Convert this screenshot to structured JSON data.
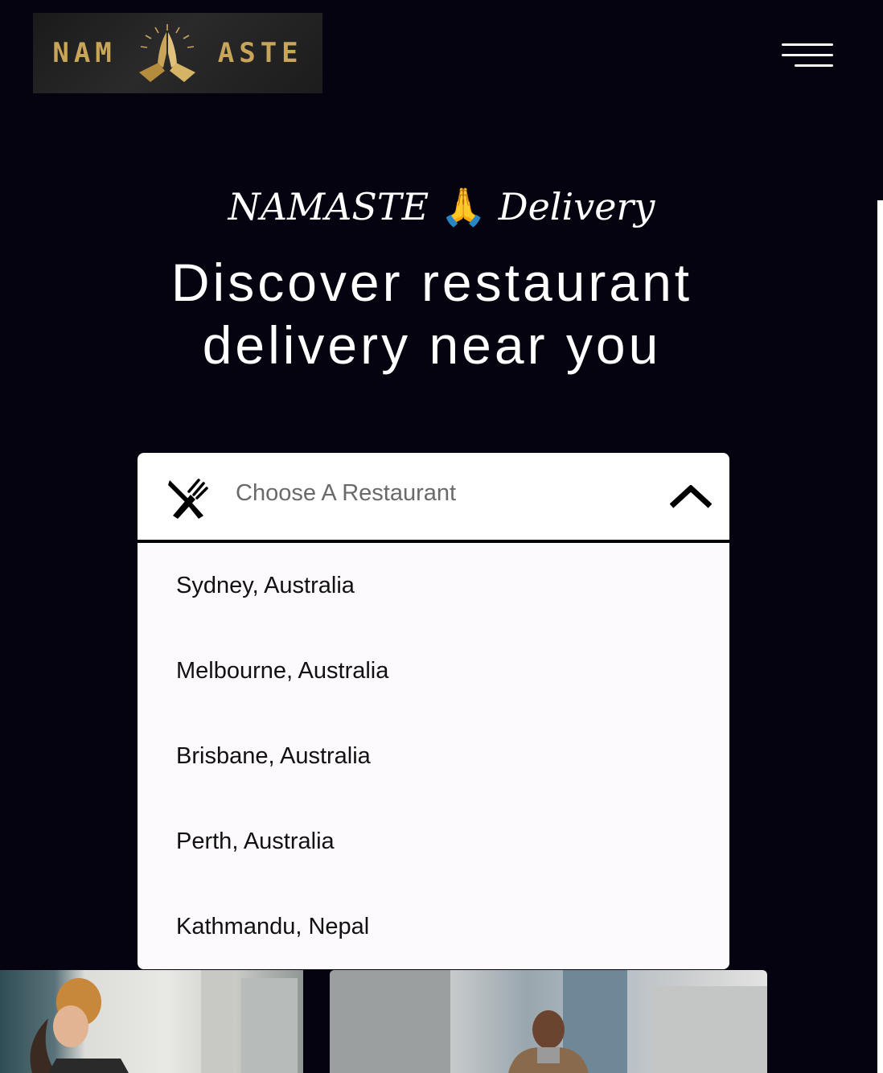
{
  "header": {
    "logo": {
      "text_left": "NAM",
      "text_right": "ASTE",
      "icon": "praying-hands-icon",
      "color": "#c9a55a"
    },
    "menu_icon": "hamburger-menu-icon"
  },
  "hero": {
    "brand_name": "NAMASTE",
    "brand_emoji": "🙏",
    "brand_suffix": "Delivery",
    "title_line1": "Discover restaurant",
    "title_line2": "delivery near you"
  },
  "restaurant_select": {
    "icon": "fork-knife-icon",
    "placeholder": "Choose A Restaurant",
    "chevron": "chevron-up-icon",
    "expanded": true,
    "options": [
      "Sydney, Australia",
      "Melbourne, Australia",
      "Brisbane, Australia",
      "Perth, Australia",
      "Kathmandu, Nepal"
    ]
  },
  "colors": {
    "background": "#05030f",
    "dropdown_bg": "#ffffff",
    "list_bg": "#fdfafd",
    "text_dark": "#111111",
    "placeholder": "#6a6a6a"
  }
}
